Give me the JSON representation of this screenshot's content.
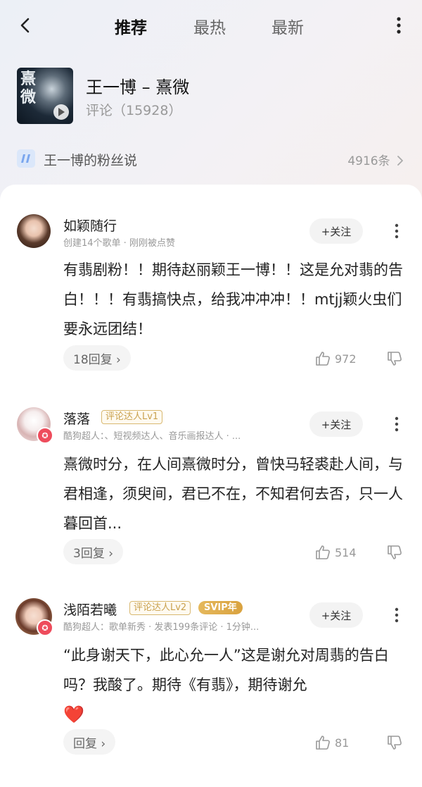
{
  "nav": {
    "tabs": [
      "推荐",
      "最热",
      "最新"
    ],
    "active_tab": "推荐"
  },
  "song": {
    "cover_text": "熹微",
    "title": "王一博 – 熹微",
    "subtitle": "评论（15928）"
  },
  "fans_row": {
    "label": "王一博的粉丝说",
    "count": "4916条"
  },
  "comments": [
    {
      "username": "如颖随行",
      "meta": "创建14个歌单 · 刚刚被点赞",
      "follow_label": "+关注",
      "text": "有翡剧粉！！期待赵丽颖王一博！！这是允对翡的告白！！！有翡搞快点，给我冲冲冲！！mtjj颖火虫们要永远团结！",
      "reply_label": "18回复 ›",
      "likes": "972"
    },
    {
      "username": "落落",
      "level_badge": "评论达人Lv1",
      "meta": "酷狗超人：、短视频达人、音乐画报达人 · ...",
      "follow_label": "+关注",
      "text": "熹微时分，在人间熹微时分，曾快马轻裘赴人间，与君相逢，须臾间，君已不在，不知君何去否，只一人暮回首...",
      "reply_label": "3回复 ›",
      "likes": "514"
    },
    {
      "username": "浅陌若曦",
      "level_badge": "评论达人Lv2",
      "svip_badge": "SVIP年",
      "meta": "酷狗超人：歌单新秀 · 发表199条评论 · 1分钟...",
      "follow_label": "+关注",
      "text": "“此身谢天下，此心允一人”这是谢允对周翡的告白吗？我酸了。期待《有翡》，期待谢允",
      "text_emoji": "❤️",
      "reply_label": "回复 ›",
      "likes": "81"
    }
  ],
  "colors": {
    "accent_badge_red": "#ee4c5c",
    "level_gold": "#c9a14e",
    "heart_red": "#e23d3d"
  }
}
